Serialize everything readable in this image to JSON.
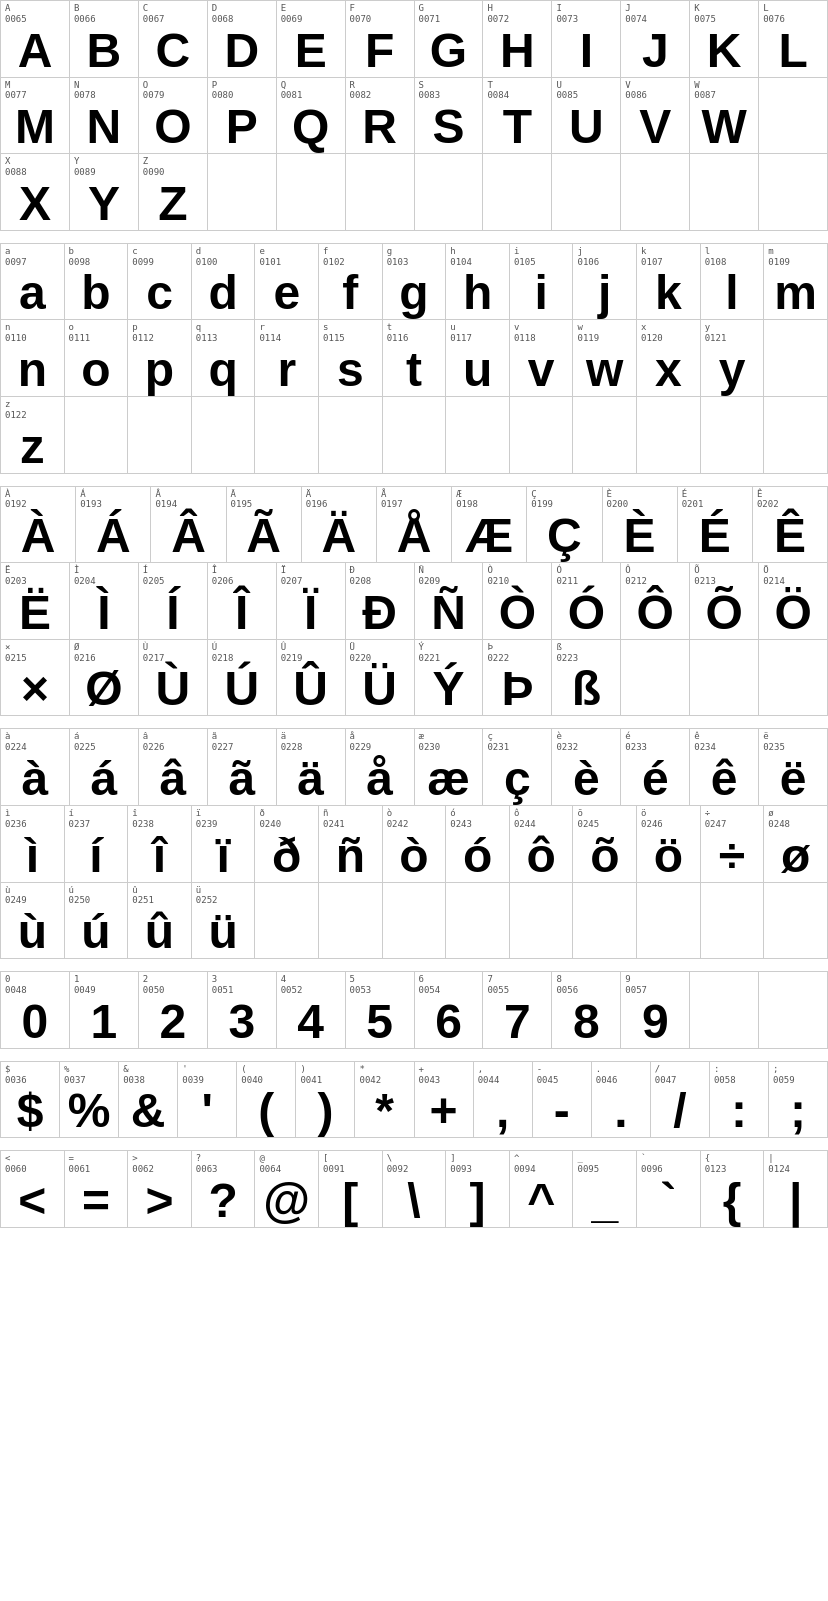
{
  "sections": [
    {
      "id": "uppercase",
      "rows": [
        {
          "cells": [
            {
              "code": "A\n0065",
              "glyph": "A"
            },
            {
              "code": "B\n0066",
              "glyph": "B"
            },
            {
              "code": "C\n0067",
              "glyph": "C"
            },
            {
              "code": "D\n0068",
              "glyph": "D"
            },
            {
              "code": "E\n0069",
              "glyph": "E"
            },
            {
              "code": "F\n0070",
              "glyph": "F"
            },
            {
              "code": "G\n0071",
              "glyph": "G"
            },
            {
              "code": "H\n0072",
              "glyph": "H"
            },
            {
              "code": "I\n0073",
              "glyph": "I"
            },
            {
              "code": "J\n0074",
              "glyph": "J"
            },
            {
              "code": "K\n0075",
              "glyph": "K"
            },
            {
              "code": "L\n0076",
              "glyph": "L"
            }
          ]
        },
        {
          "cells": [
            {
              "code": "M\n0077",
              "glyph": "M"
            },
            {
              "code": "N\n0078",
              "glyph": "N"
            },
            {
              "code": "O\n0079",
              "glyph": "O"
            },
            {
              "code": "P\n0080",
              "glyph": "P"
            },
            {
              "code": "Q\n0081",
              "glyph": "Q"
            },
            {
              "code": "R\n0082",
              "glyph": "R"
            },
            {
              "code": "S\n0083",
              "glyph": "S"
            },
            {
              "code": "T\n0084",
              "glyph": "T"
            },
            {
              "code": "U\n0085",
              "glyph": "U"
            },
            {
              "code": "V\n0086",
              "glyph": "V"
            },
            {
              "code": "W\n0087",
              "glyph": "W"
            }
          ],
          "padEnd": 1
        },
        {
          "cells": [
            {
              "code": "X\n0088",
              "glyph": "X"
            },
            {
              "code": "Y\n0089",
              "glyph": "Y"
            },
            {
              "code": "Z\n0090",
              "glyph": "Z"
            }
          ],
          "padEnd": 9
        }
      ]
    },
    {
      "id": "lowercase",
      "rows": [
        {
          "cells": [
            {
              "code": "a\n0097",
              "glyph": "a"
            },
            {
              "code": "b\n0098",
              "glyph": "b"
            },
            {
              "code": "c\n0099",
              "glyph": "c"
            },
            {
              "code": "d\n0100",
              "glyph": "d"
            },
            {
              "code": "e\n0101",
              "glyph": "e"
            },
            {
              "code": "f\n0102",
              "glyph": "f"
            },
            {
              "code": "g\n0103",
              "glyph": "g"
            },
            {
              "code": "h\n0104",
              "glyph": "h"
            },
            {
              "code": "i\n0105",
              "glyph": "i"
            },
            {
              "code": "j\n0106",
              "glyph": "j"
            },
            {
              "code": "k\n0107",
              "glyph": "k"
            },
            {
              "code": "l\n0108",
              "glyph": "l"
            },
            {
              "code": "m\n0109",
              "glyph": "m"
            }
          ]
        },
        {
          "cells": [
            {
              "code": "n\n0110",
              "glyph": "n"
            },
            {
              "code": "o\n0111",
              "glyph": "o"
            },
            {
              "code": "p\n0112",
              "glyph": "p"
            },
            {
              "code": "q\n0113",
              "glyph": "q"
            },
            {
              "code": "r\n0114",
              "glyph": "r"
            },
            {
              "code": "s\n0115",
              "glyph": "s"
            },
            {
              "code": "t\n0116",
              "glyph": "t"
            },
            {
              "code": "u\n0117",
              "glyph": "u"
            },
            {
              "code": "v\n0118",
              "glyph": "v"
            },
            {
              "code": "w\n0119",
              "glyph": "w"
            },
            {
              "code": "x\n0120",
              "glyph": "x"
            },
            {
              "code": "y\n0121",
              "glyph": "y"
            }
          ],
          "padEnd": 1
        },
        {
          "cells": [
            {
              "code": "z\n0122",
              "glyph": "z"
            }
          ],
          "padEnd": 12
        }
      ]
    },
    {
      "id": "extended1",
      "rows": [
        {
          "cells": [
            {
              "code": "À\n0192",
              "glyph": "À"
            },
            {
              "code": "Á\n0193",
              "glyph": "Á"
            },
            {
              "code": "Â\n0194",
              "glyph": "Â"
            },
            {
              "code": "Ã\n0195",
              "glyph": "Ã"
            },
            {
              "code": "Ä\n0196",
              "glyph": "Ä"
            },
            {
              "code": "Å\n0197",
              "glyph": "Å"
            },
            {
              "code": "Æ\n0198",
              "glyph": "Æ"
            },
            {
              "code": "Ç\n0199",
              "glyph": "Ç"
            },
            {
              "code": "È\n0200",
              "glyph": "È"
            },
            {
              "code": "É\n0201",
              "glyph": "É"
            },
            {
              "code": "Ê\n0202",
              "glyph": "Ê"
            }
          ],
          "padEnd": 0
        },
        {
          "cells": [
            {
              "code": "Ë\n0203",
              "glyph": "Ë"
            },
            {
              "code": "Ì\n0204",
              "glyph": "Ì"
            },
            {
              "code": "Í\n0205",
              "glyph": "Í"
            },
            {
              "code": "Î\n0206",
              "glyph": "Î"
            },
            {
              "code": "Ï\n0207",
              "glyph": "Ï"
            },
            {
              "code": "Ð\n0208",
              "glyph": "Ð"
            },
            {
              "code": "Ñ\n0209",
              "glyph": "Ñ"
            },
            {
              "code": "Ò\n0210",
              "glyph": "Ò"
            },
            {
              "code": "Ó\n0211",
              "glyph": "Ó"
            },
            {
              "code": "Ô\n0212",
              "glyph": "Ô"
            },
            {
              "code": "Õ\n0213",
              "glyph": "Õ"
            },
            {
              "code": "Ö\n0214",
              "glyph": "Ö"
            }
          ],
          "padEnd": 0
        },
        {
          "cells": [
            {
              "code": "×\n0215",
              "glyph": "×"
            },
            {
              "code": "Ø\n0216",
              "glyph": "Ø"
            },
            {
              "code": "Ù\n0217",
              "glyph": "Ù"
            },
            {
              "code": "Ú\n0218",
              "glyph": "Ú"
            },
            {
              "code": "Û\n0219",
              "glyph": "Û"
            },
            {
              "code": "Ü\n0220",
              "glyph": "Ü"
            },
            {
              "code": "Ý\n0221",
              "glyph": "Ý"
            },
            {
              "code": "Þ\n0222",
              "glyph": "Þ"
            },
            {
              "code": "ß\n0223",
              "glyph": "ß"
            }
          ],
          "padEnd": 3
        }
      ]
    },
    {
      "id": "extended2",
      "rows": [
        {
          "cells": [
            {
              "code": "à\n0224",
              "glyph": "à"
            },
            {
              "code": "á\n0225",
              "glyph": "á"
            },
            {
              "code": "â\n0226",
              "glyph": "â"
            },
            {
              "code": "ã\n0227",
              "glyph": "ã"
            },
            {
              "code": "ä\n0228",
              "glyph": "ä"
            },
            {
              "code": "å\n0229",
              "glyph": "å"
            },
            {
              "code": "æ\n0230",
              "glyph": "æ"
            },
            {
              "code": "ç\n0231",
              "glyph": "ç"
            },
            {
              "code": "è\n0232",
              "glyph": "è"
            },
            {
              "code": "é\n0233",
              "glyph": "é"
            },
            {
              "code": "ê\n0234",
              "glyph": "ê"
            },
            {
              "code": "ë\n0235",
              "glyph": "ë"
            }
          ]
        },
        {
          "cells": [
            {
              "code": "ì\n0236",
              "glyph": "ì"
            },
            {
              "code": "í\n0237",
              "glyph": "í"
            },
            {
              "code": "î\n0238",
              "glyph": "î"
            },
            {
              "code": "ï\n0239",
              "glyph": "ï"
            },
            {
              "code": "ð\n0240",
              "glyph": "ð"
            },
            {
              "code": "ñ\n0241",
              "glyph": "ñ"
            },
            {
              "code": "ò\n0242",
              "glyph": "ò"
            },
            {
              "code": "ó\n0243",
              "glyph": "ó"
            },
            {
              "code": "ô\n0244",
              "glyph": "ô"
            },
            {
              "code": "õ\n0245",
              "glyph": "õ"
            },
            {
              "code": "ö\n0246",
              "glyph": "ö"
            },
            {
              "code": "÷\n0247",
              "glyph": "÷"
            },
            {
              "code": "ø\n0248",
              "glyph": "ø"
            }
          ]
        },
        {
          "cells": [
            {
              "code": "ù\n0249",
              "glyph": "ù"
            },
            {
              "code": "ú\n0250",
              "glyph": "ú"
            },
            {
              "code": "û\n0251",
              "glyph": "û"
            },
            {
              "code": "ü\n0252",
              "glyph": "ü"
            }
          ],
          "padEnd": 9
        }
      ]
    },
    {
      "id": "digits",
      "rows": [
        {
          "cells": [
            {
              "code": "0\n0048",
              "glyph": "0"
            },
            {
              "code": "1\n0049",
              "glyph": "1"
            },
            {
              "code": "2\n0050",
              "glyph": "2"
            },
            {
              "code": "3\n0051",
              "glyph": "3"
            },
            {
              "code": "4\n0052",
              "glyph": "4"
            },
            {
              "code": "5\n0053",
              "glyph": "5"
            },
            {
              "code": "6\n0054",
              "glyph": "6"
            },
            {
              "code": "7\n0055",
              "glyph": "7"
            },
            {
              "code": "8\n0056",
              "glyph": "8"
            },
            {
              "code": "9\n0057",
              "glyph": "9"
            }
          ],
          "padEnd": 2
        }
      ]
    },
    {
      "id": "special1",
      "rows": [
        {
          "cells": [
            {
              "code": "$\n0036",
              "glyph": "$"
            },
            {
              "code": "%\n0037",
              "glyph": "%"
            },
            {
              "code": "&\n0038",
              "glyph": "&"
            },
            {
              "code": "'\n0039",
              "glyph": "'"
            },
            {
              "code": "(\n0040",
              "glyph": "("
            },
            {
              "code": ")\n0041",
              "glyph": ")"
            },
            {
              "code": "*\n0042",
              "glyph": "*"
            },
            {
              "code": "+\n0043",
              "glyph": "+"
            },
            {
              "code": ",\n0044",
              "glyph": ","
            },
            {
              "code": "-\n0045",
              "glyph": "-"
            },
            {
              "code": ".\n0046",
              "glyph": "."
            },
            {
              "code": "/\n0047",
              "glyph": "/"
            },
            {
              "code": ":\n0058",
              "glyph": ":"
            },
            {
              "code": ";\n0059",
              "glyph": ";"
            }
          ]
        }
      ]
    },
    {
      "id": "special2",
      "rows": [
        {
          "cells": [
            {
              "code": "<\n0060",
              "glyph": "<"
            },
            {
              "code": "=\n0061",
              "glyph": "="
            },
            {
              "code": ">\n0062",
              "glyph": ">"
            },
            {
              "code": "?\n0063",
              "glyph": "?"
            },
            {
              "code": "@\n0064",
              "glyph": "@"
            },
            {
              "code": "[\n0091",
              "glyph": "["
            },
            {
              "code": "\\\n0092",
              "glyph": "\\"
            },
            {
              "code": "]\n0093",
              "glyph": "]"
            },
            {
              "code": "^\n0094",
              "glyph": "^"
            },
            {
              "code": "_\n0095",
              "glyph": "_"
            },
            {
              "code": "`\n0096",
              "glyph": "`"
            },
            {
              "code": "{\n0123",
              "glyph": "{"
            },
            {
              "code": "|\n0124",
              "glyph": "|"
            }
          ]
        }
      ]
    }
  ]
}
